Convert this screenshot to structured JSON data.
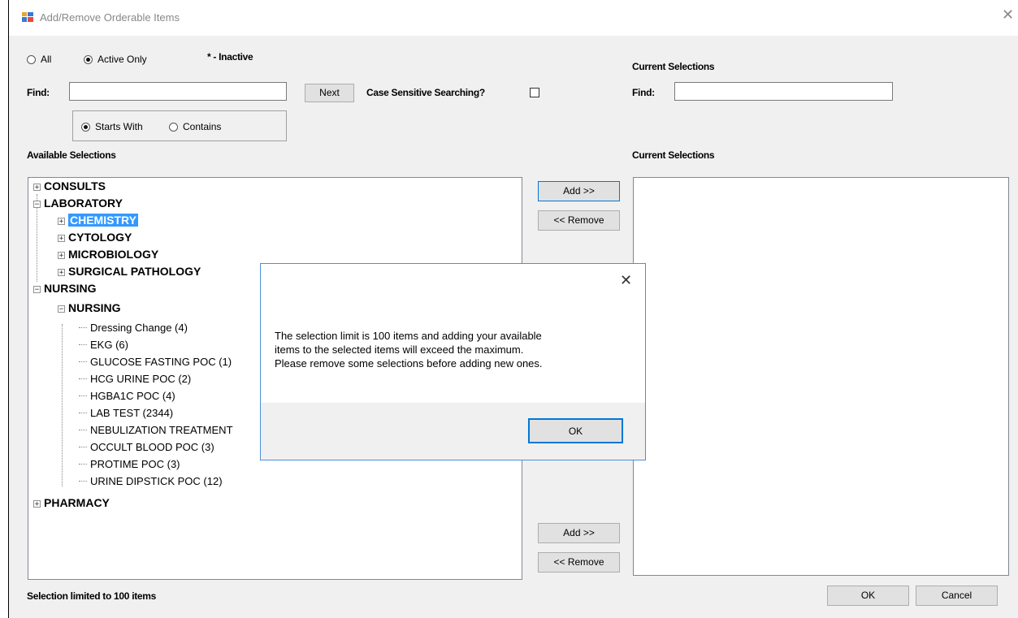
{
  "window": {
    "title": "Add/Remove Orderable Items",
    "icons": {
      "app": "app-window-icon",
      "close": "close-icon"
    }
  },
  "filter": {
    "all_label": "All",
    "active_only_label": "Active Only",
    "active_only_selected": true,
    "inactive_note": "* - Inactive"
  },
  "find_left": {
    "label": "Find:",
    "value": "",
    "next_label": "Next",
    "case_sensitive_label": "Case Sensitive Searching?",
    "case_sensitive_checked": false,
    "starts_with_label": "Starts With",
    "contains_label": "Contains",
    "starts_with_selected": true
  },
  "find_right": {
    "heading": "Current Selections",
    "label": "Find:",
    "value": ""
  },
  "available": {
    "heading": "Available Selections",
    "tree": {
      "consults": "CONSULTS",
      "laboratory": "LABORATORY",
      "chemistry": "CHEMISTRY",
      "cytology": "CYTOLOGY",
      "microbiology": "MICROBIOLOGY",
      "surgical_pathology": "SURGICAL PATHOLOGY",
      "nursing": "NURSING",
      "nursing_sub": "NURSING",
      "pharmacy": "PHARMACY",
      "nursing_items": [
        "Dressing Change (4)",
        "EKG (6)",
        "GLUCOSE FASTING POC (1)",
        "HCG URINE POC (2)",
        "HGBA1C POC (4)",
        "LAB TEST (2344)",
        "NEBULIZATION TREATMENT",
        "OCCULT BLOOD POC (3)",
        "PROTIME POC (3)",
        "URINE DIPSTICK POC (12)"
      ]
    }
  },
  "current": {
    "heading": "Current Selections"
  },
  "buttons": {
    "add": "Add >>",
    "remove": "<< Remove",
    "ok": "OK",
    "cancel": "Cancel"
  },
  "footer": {
    "limit_note": "Selection limited to 100 items"
  },
  "dialog": {
    "message_lines": [
      "The selection limit is 100 items and adding your available",
      "items to the selected items will exceed the maximum.",
      "Please remove some selections before adding new ones."
    ],
    "ok_label": "OK"
  }
}
